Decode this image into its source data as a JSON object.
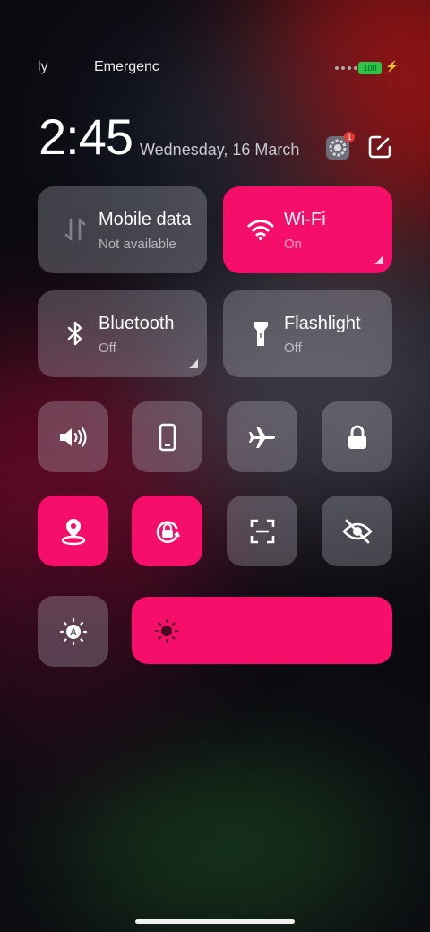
{
  "status": {
    "carrier1": "ly",
    "carrier2": "Emergenc",
    "battery": "100"
  },
  "header": {
    "time": "2:45",
    "date": "Wednesday, 16 March",
    "notification_badge": "1"
  },
  "toggles": [
    {
      "title": "Mobile data",
      "sub": "Not available",
      "state": "off",
      "icon": "mobile-data-icon"
    },
    {
      "title": "Wi-Fi",
      "sub": "On",
      "state": "on",
      "icon": "wifi-icon"
    },
    {
      "title": "Bluetooth",
      "sub": "Off",
      "state": "off",
      "icon": "bluetooth-icon"
    },
    {
      "title": "Flashlight",
      "sub": "Off",
      "state": "off",
      "icon": "flashlight-icon"
    }
  ],
  "quick_row1": [
    {
      "icon": "sound-icon",
      "state": "off"
    },
    {
      "icon": "vibrate-icon",
      "state": "off"
    },
    {
      "icon": "airplane-icon",
      "state": "off"
    },
    {
      "icon": "lock-screen-icon",
      "state": "off"
    }
  ],
  "quick_row2": [
    {
      "icon": "location-icon",
      "state": "on"
    },
    {
      "icon": "rotation-lock-icon",
      "state": "on"
    },
    {
      "icon": "scanner-icon",
      "state": "off"
    },
    {
      "icon": "eye-off-icon",
      "state": "off"
    }
  ],
  "brightness": {
    "auto_icon": "auto-brightness-icon",
    "slider_icon": "brightness-icon",
    "level_fraction": 1.0
  },
  "colors": {
    "accent": "#f50e6a",
    "tile_off": "rgba(205,205,215,0.28)"
  }
}
